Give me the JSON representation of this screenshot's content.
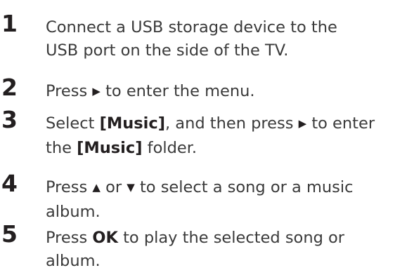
{
  "steps": [
    {
      "number": "1",
      "line1": "Connect a USB storage device to the",
      "line2": "USB port on the side of the TV."
    },
    {
      "number": "2",
      "press": "Press",
      "arrow": "▶",
      "rest": "to enter the menu."
    },
    {
      "number": "3",
      "select": "Select",
      "music": "[Music]",
      "mid": ", and then press",
      "arrow": "▶",
      "to_enter": "to enter",
      "the": "the",
      "music2": "[Music]",
      "folder": "folder."
    },
    {
      "number": "4",
      "press": "Press",
      "up": "▲",
      "or": "or",
      "down": "▼",
      "rest": "to select a song or a music",
      "line2": "album."
    },
    {
      "number": "5",
      "press": "Press",
      "ok": "OK",
      "rest": "to play the selected song or",
      "line2": "album."
    }
  ]
}
